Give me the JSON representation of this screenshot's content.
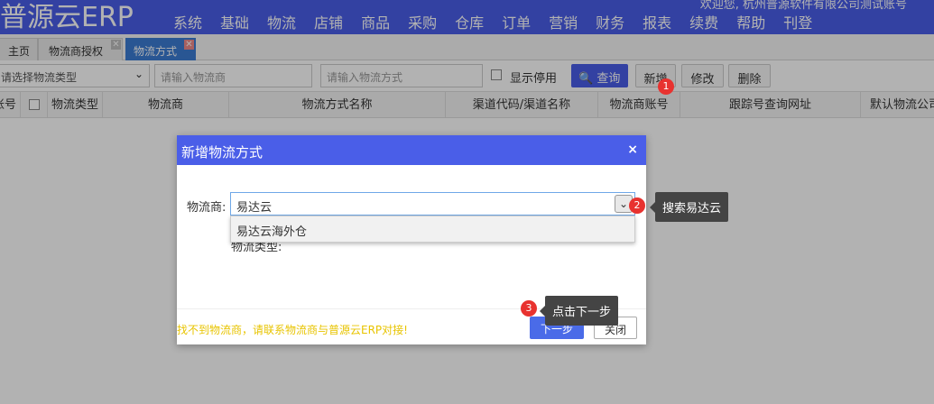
{
  "app": {
    "logo": "普源云ERP",
    "welcome": "欢迎您, 杭州普源软件有限公司测试账号"
  },
  "nav": [
    "系统",
    "基础",
    "物流",
    "店铺",
    "商品",
    "采购",
    "仓库",
    "订单",
    "营销",
    "财务",
    "报表",
    "续费",
    "帮助",
    "刊登"
  ],
  "tabs": [
    {
      "label": "主页"
    },
    {
      "label": "物流商授权"
    },
    {
      "label": "物流方式"
    }
  ],
  "toolbar": {
    "type_select": "请选择物流类型",
    "carrier_placeholder": "请输入物流商",
    "method_placeholder": "请输入物流方式",
    "show_disabled": "显示停用",
    "query": "查询",
    "add": "新增",
    "edit": "修改",
    "delete": "删除"
  },
  "table": {
    "columns": [
      "账号",
      "物流类型",
      "物流商",
      "物流方式名称",
      "渠道代码/渠道名称",
      "物流商账号",
      "跟踪号查询网址",
      "默认物流公司"
    ]
  },
  "modal": {
    "title": "新增物流方式",
    "close": "×",
    "carrier_label": "物流商:",
    "carrier_value": "易达云",
    "dropdown_option": "易达云海外仓",
    "type_label": "物流类型:",
    "hint": "找不到物流商，请联系物流商与普源云ERP对接!",
    "next": "下一步",
    "close_btn": "关闭"
  },
  "annotations": [
    {
      "number": "1"
    },
    {
      "number": "2",
      "text": "搜索易达云"
    },
    {
      "number": "3",
      "text": "点击下一步"
    }
  ],
  "colors": {
    "brand": "#4a5ee8",
    "active_tab": "#3b7cd3",
    "hint": "#e8c400",
    "badge": "#e8322f"
  }
}
